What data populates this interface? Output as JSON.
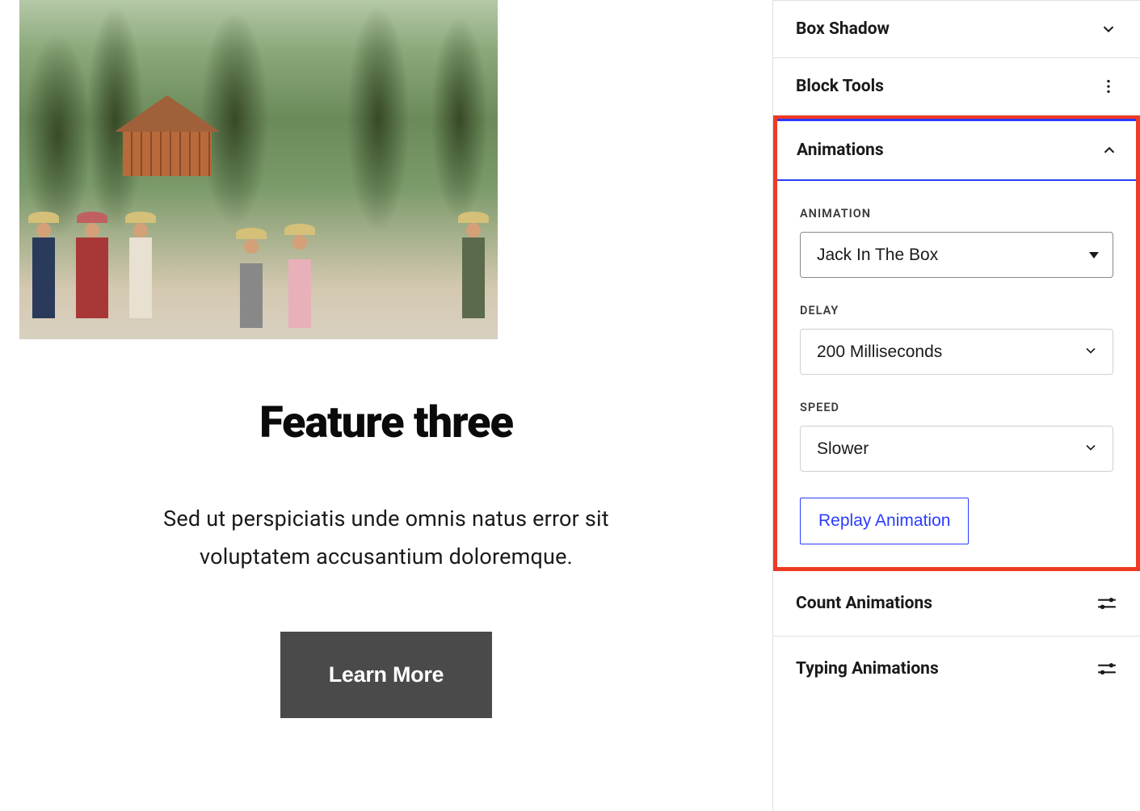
{
  "main": {
    "feature_title": "Feature three",
    "feature_text": "Sed ut perspiciatis unde omnis natus error sit voluptatem accusantium doloremque.",
    "learn_more_label": "Learn More"
  },
  "sidebar": {
    "box_shadow_label": "Box Shadow",
    "block_tools_label": "Block Tools",
    "animations_panel": {
      "title": "Animations",
      "fields": {
        "animation_label": "ANIMATION",
        "animation_value": "Jack In The Box",
        "delay_label": "DELAY",
        "delay_value": "200 Milliseconds",
        "speed_label": "SPEED",
        "speed_value": "Slower"
      },
      "replay_label": "Replay Animation"
    },
    "count_animations_label": "Count Animations",
    "typing_animations_label": "Typing Animations"
  }
}
